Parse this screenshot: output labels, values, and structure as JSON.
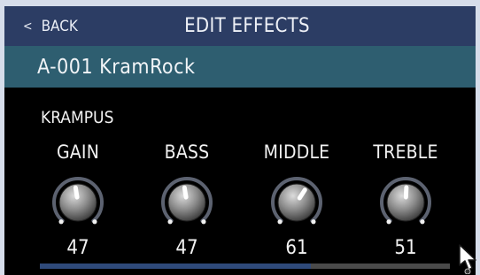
{
  "header": {
    "back_label": "BACK",
    "title": "EDIT EFFECTS"
  },
  "patch": {
    "name": "A-001 KramRock"
  },
  "effect": {
    "name": "KRAMPUS",
    "params": [
      {
        "label": "GAIN",
        "value": "47"
      },
      {
        "label": "BASS",
        "value": "47"
      },
      {
        "label": "MIDDLE",
        "value": "61"
      },
      {
        "label": "TREBLE",
        "value": "51"
      }
    ]
  },
  "scroll": {
    "position_fraction": 0.66
  },
  "icons": {
    "back": "chevron-left-icon",
    "pointer": "mouse-pointer-icon"
  },
  "colors": {
    "header_bg": "#2c3d64",
    "patch_bar_bg": "#2e5e70",
    "screen_bg": "#000000",
    "scroll_thumb": "#2f4a7a",
    "scroll_track": "#4a4a4a"
  }
}
